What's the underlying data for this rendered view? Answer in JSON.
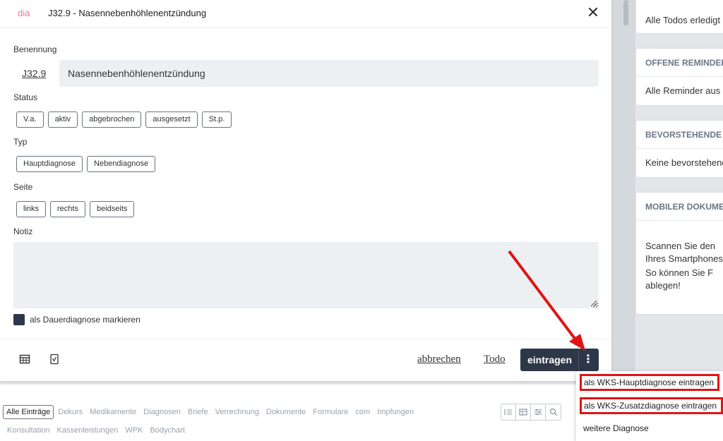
{
  "modal": {
    "brand": "dia",
    "title": "J32.9 - Nasennebenhöhlenentzündung",
    "close_glyph": "✕",
    "benennung_label": "Benennung",
    "code": "J32.9",
    "name_value": "Nasennebenhöhlenentzündung",
    "status_label": "Status",
    "status_options": [
      "V.a.",
      "aktiv",
      "abgebrochen",
      "ausgesetzt",
      "St.p."
    ],
    "typ_label": "Typ",
    "typ_options": [
      "Hauptdiagnose",
      "Nebendiagnose"
    ],
    "seite_label": "Seite",
    "seite_options": [
      "links",
      "rechts",
      "beidseits"
    ],
    "notiz_label": "Notiz",
    "notiz_value": "",
    "dauer_label": "als Dauerdiagnose markieren",
    "cancel_label": "abbrechen",
    "todo_label": "Todo",
    "submit_label": "eintragen",
    "kebab_glyph": "⋮"
  },
  "dropdown": {
    "items": [
      "als WKS-Hauptdiagnose eintragen",
      "als WKS-Zusatzdiagnose eintragen",
      "weitere Diagnose"
    ]
  },
  "sidebar": {
    "todos_body": "Alle Todos erledigt",
    "reminder_head": "OFFENE REMINDER",
    "reminder_body": "Alle Reminder aus",
    "upcoming_head": "BEVORSTEHENDE",
    "upcoming_body": "Keine bevorstehenden",
    "mobile_head": "MOBILER DOKUMENT",
    "mobile_line1": "Scannen Sie den",
    "mobile_line2": "Ihres Smartphones",
    "mobile_line3": "So können Sie F",
    "mobile_line4": "ablegen!"
  },
  "tabs": {
    "row1": [
      "Alle Einträge",
      "Dekurs",
      "Medikamente",
      "Diagnosen",
      "Briefe",
      "Verrechnung",
      "Dokumente",
      "Formulare",
      "com",
      "Impfungen"
    ],
    "row2": [
      "Konsultation",
      "Kassenleistungen",
      "WPK",
      "Bodychart"
    ]
  },
  "colors": {
    "brand": "#e8739f",
    "primary": "#2e3748",
    "highlight": "#e01414"
  }
}
